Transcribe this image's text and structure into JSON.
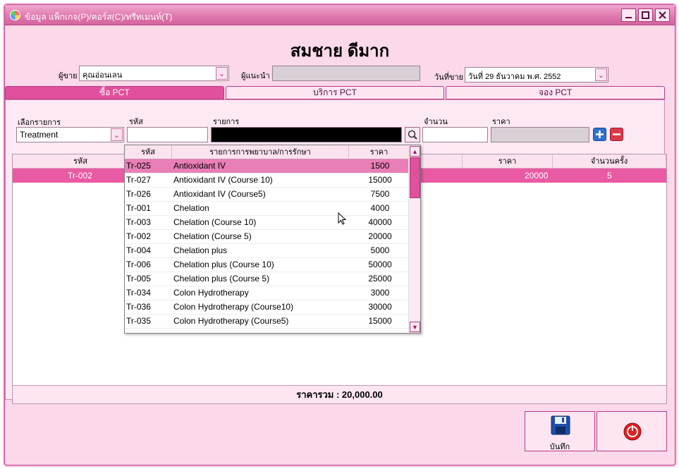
{
  "window": {
    "title": "ข้อมูล แพ็กเกจ(P)/คอร์ส(C)/ทรีทเมนท์(T)"
  },
  "customer_name": "สมชาย ดีมาก",
  "header": {
    "seller_label": "ผู้ขาย",
    "seller_value": "คุณอ่อนเลน",
    "referrer_label": "ผู้แนะนำ",
    "referrer_value": "",
    "date_label": "วันที่ขาย",
    "date_value": "วันที่ 29  ธันวาคม  พ.ศ.  2552"
  },
  "tabs": [
    {
      "label": "ซื้อ PCT",
      "active": true
    },
    {
      "label": "บริการ PCT",
      "active": false
    },
    {
      "label": "จอง PCT",
      "active": false
    }
  ],
  "entry": {
    "select_label": "เลือกรายการ",
    "select_value": "Treatment",
    "code_label": "รหัส",
    "code_value": "",
    "item_label": "รายการ",
    "item_value": "",
    "qty_label": "จำนวน",
    "qty_value": "",
    "price_label": "ราคา",
    "price_value": ""
  },
  "grid": {
    "headers": [
      "รหัส",
      "ราคา",
      "จำนวนครั้ง"
    ],
    "rows": [
      {
        "code": "Tr-002",
        "price": "20000",
        "count": "5"
      }
    ],
    "total": "ราคารวม : 20,000.00"
  },
  "popup": {
    "headers": [
      "รหัส",
      "รายการการพยาบาล/การรักษา",
      "ราคา"
    ],
    "rows": [
      {
        "code": "Tr-025",
        "name": "Antioxidant IV",
        "price": "1500"
      },
      {
        "code": "Tr-027",
        "name": "Antioxidant IV (Course 10)",
        "price": "15000"
      },
      {
        "code": "Tr-026",
        "name": "Antioxidant IV (Course5)",
        "price": "7500"
      },
      {
        "code": "Tr-001",
        "name": "Chelation",
        "price": "4000"
      },
      {
        "code": "Tr-003",
        "name": "Chelation (Course 10)",
        "price": "40000"
      },
      {
        "code": "Tr-002",
        "name": "Chelation (Course 5)",
        "price": "20000"
      },
      {
        "code": "Tr-004",
        "name": "Chelation plus",
        "price": "5000"
      },
      {
        "code": "Tr-006",
        "name": "Chelation plus (Course 10)",
        "price": "50000"
      },
      {
        "code": "Tr-005",
        "name": "Chelation plus (Course 5)",
        "price": "25000"
      },
      {
        "code": "Tr-034",
        "name": "Colon Hydrotherapy",
        "price": "3000"
      },
      {
        "code": "Tr-036",
        "name": "Colon Hydrotherapy (Course10)",
        "price": "30000"
      },
      {
        "code": "Tr-035",
        "name": "Colon Hydrotherapy (Course5)",
        "price": "15000"
      }
    ]
  },
  "buttons": {
    "save_label": "บันทึก"
  },
  "colors": {
    "accent": "#e0509c",
    "background": "#fbd8ea",
    "selection": "#e85aa3"
  }
}
